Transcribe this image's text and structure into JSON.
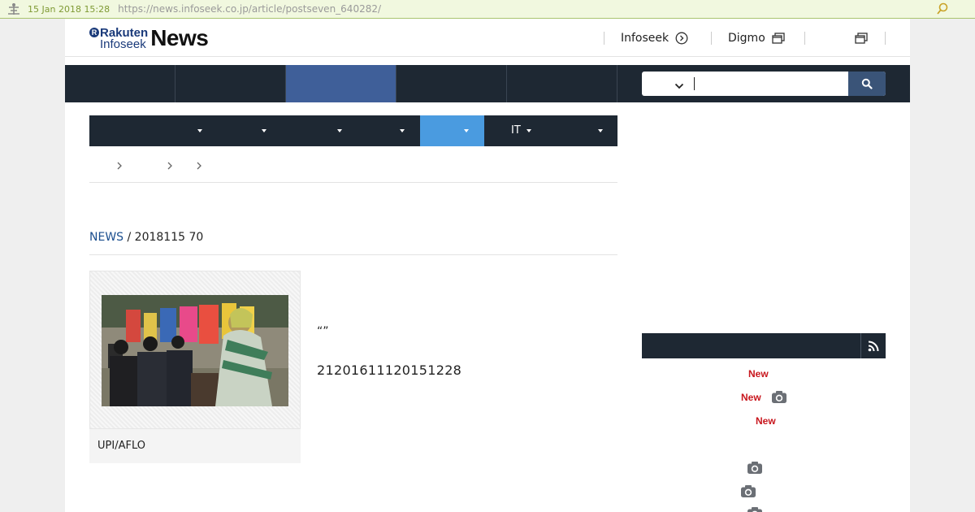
{
  "archive": {
    "date": "15 Jan 2018 15:28",
    "url": "https://news.infoseek.co.jp/article/postseven_640282/"
  },
  "header": {
    "brand_rakuten": "Rakuten",
    "brand_infoseek": "Infoseek",
    "brand_news": "News",
    "links": [
      "Infoseek",
      "Digmo"
    ]
  },
  "article": {
    "meta_link": "NEWS",
    "meta_rest": " / 2018115 70",
    "photo_credit": "UPI/AFLO",
    "quote": "“”",
    "body_number": "21201611120151228"
  },
  "subnav": {
    "it_label": "IT"
  },
  "sidebar": {
    "new_badges": [
      "New",
      "New",
      "New"
    ]
  },
  "colors": {
    "nav_dark": "#1e2833",
    "nav_active": "#3f5f99",
    "subnav_active": "#4a9be0",
    "link": "#1a4e8e",
    "new_badge": "#c8161d"
  }
}
